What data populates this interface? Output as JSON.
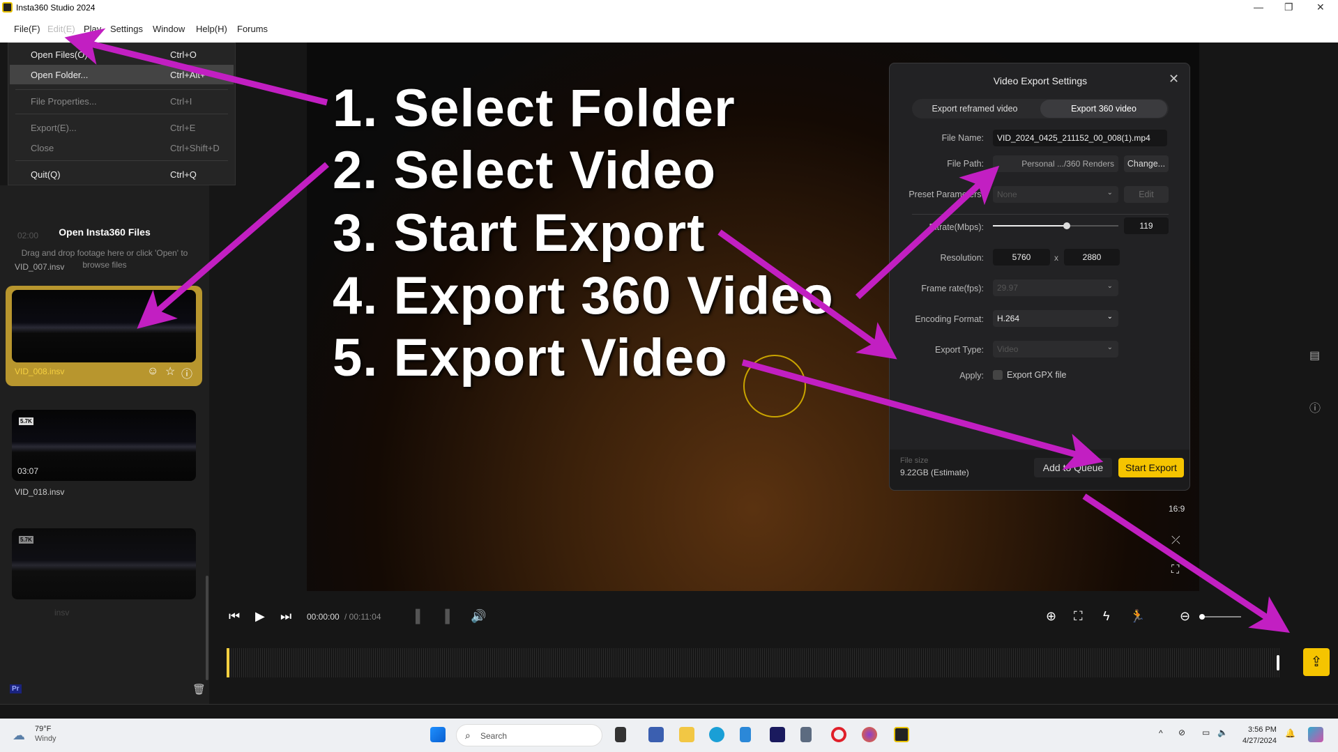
{
  "window": {
    "title": "Insta360 Studio 2024",
    "controls": [
      "—",
      "❐",
      "✕"
    ]
  },
  "menubar": {
    "items": [
      "File(F)",
      "Edit(E)",
      "Play",
      "Settings",
      "Window",
      "Help(H)",
      "Forums"
    ]
  },
  "file_menu": [
    {
      "label": "Open Files(O)...",
      "shortcut": "Ctrl+O"
    },
    {
      "label": "Open Folder...",
      "shortcut": "Ctrl+Alt+"
    },
    {
      "label": "File Properties...",
      "shortcut": "Ctrl+I"
    },
    {
      "label": "Export(E)...",
      "shortcut": "Ctrl+E"
    },
    {
      "label": "Close",
      "shortcut": "Ctrl+Shift+D"
    },
    {
      "label": "Quit(Q)",
      "shortcut": "Ctrl+Q"
    }
  ],
  "left_panel": {
    "title": "Open Insta360 Files",
    "subtitle": "Drag and drop footage here or click 'Open' to browse files",
    "files": [
      {
        "name": "VID_007.insv",
        "duration": "02:00"
      },
      {
        "name": "VID_008.insv",
        "selected": true
      },
      {
        "name": "VID_018.insv",
        "duration": "03:07",
        "badge": "5.7K"
      },
      {
        "name": "insv",
        "badge": "5.7K"
      }
    ],
    "pr_label": "Pr"
  },
  "annotations": [
    "1. Select Folder",
    "2. Select Video",
    "3. Start Export",
    "4. Export 360 Video",
    "5. Export Video"
  ],
  "annotation_color": "#c21fc2",
  "player": {
    "time_current": "00:00:00",
    "time_total": "/ 00:11:04",
    "aspect": "16:9"
  },
  "dialog": {
    "title": "Video Export Settings",
    "tabs": [
      "Export reframed video",
      "Export 360 video"
    ],
    "active_tab": 1,
    "file_name_label": "File Name:",
    "file_name": "VID_2024_0425_211152_00_008(1).mp4",
    "file_path_label": "File Path:",
    "file_path": "Personal .../360 Renders",
    "change_label": "Change...",
    "preset_label": "Preset Parameters:",
    "preset_value": "None",
    "edit_label": "Edit",
    "bitrate_label": "Bitrate(Mbps):",
    "bitrate": "119",
    "bitrate_fraction": 0.59,
    "resolution_label": "Resolution:",
    "res_w": "5760",
    "res_x": "x",
    "res_h": "2880",
    "framerate_label": "Frame rate(fps):",
    "framerate": "29.97",
    "encoding_label": "Encoding Format:",
    "encoding": "H.264",
    "export_type_label": "Export Type:",
    "export_type": "Video",
    "apply_label": "Apply:",
    "gpx_label": "Export GPX file",
    "gpx_checked": false,
    "file_size_label": "File size",
    "file_size": "9.22GB (Estimate)",
    "queue_label": "Add to Queue",
    "start_label": "Start Export"
  },
  "taskbar": {
    "weather_temp": "79°F",
    "weather_desc": "Windy",
    "search_placeholder": "Search",
    "time": "3:56 PM",
    "date": "4/27/2024"
  },
  "accent": "#f5c400"
}
